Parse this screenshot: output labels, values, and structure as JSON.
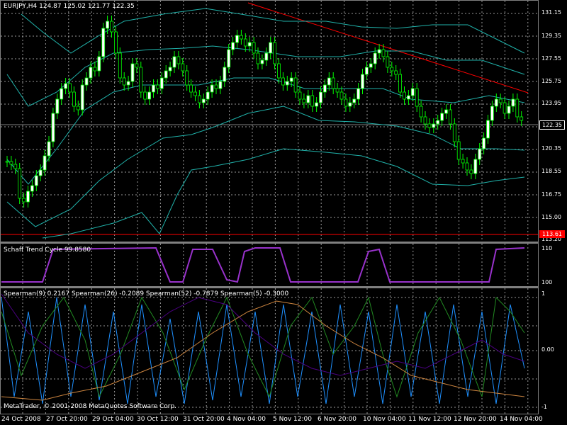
{
  "window": {
    "header_text": "EURJPY,H4  124.87 125.02 121.77 122.35",
    "copyright": "MetaTrader, © 2001-2008 MetaQuotes Software Corp."
  },
  "colors": {
    "background": "#000000",
    "grid": "#C0C0C0",
    "bull_candle": "#FFFFFF",
    "bear_candle": "#000000",
    "candle_outline": "#00FF00",
    "bands": "#20B2AA",
    "trendline": "#FF0000",
    "schaff": "#9932CC",
    "spearman_9": "#1E90FF",
    "spearman_26": "#228B22",
    "spearman_52": "#4B0082",
    "spearman_5": "#CD853F"
  },
  "main_chart": {
    "symbol": "EURJPY,H4",
    "open": "124.87",
    "high": "125.02",
    "low": "121.77",
    "close": "122.35",
    "current_price_label": "122.35",
    "support_line_label": "113.61",
    "price_scale": [
      "131.15",
      "129.35",
      "127.55",
      "125.75",
      "123.95",
      "122.35",
      "120.35",
      "118.55",
      "116.75",
      "115.00",
      "113.20"
    ]
  },
  "schaff": {
    "label": "Schaff Trend Cycle 99.8580",
    "value": 99.858,
    "scale": [
      "110",
      "100"
    ]
  },
  "spearman": {
    "label": "Spearman(9) 0.2167  Spearman(26) -0.2089  Spearman(52) -0.7879  Spearman(5) -0.3000",
    "scale": [
      "1",
      "0.00",
      "-1"
    ]
  },
  "time_axis": [
    "24 Oct 2008",
    "27 Oct 20:00",
    "29 Oct 04:00",
    "30 Oct 12:00",
    "31 Oct 20:00",
    "4 Nov 04:00",
    "5 Nov 12:00",
    "6 Nov 20:00",
    "10 Nov 04:00",
    "11 Nov 12:00",
    "12 Nov 20:00",
    "14 Nov 04:00"
  ]
}
